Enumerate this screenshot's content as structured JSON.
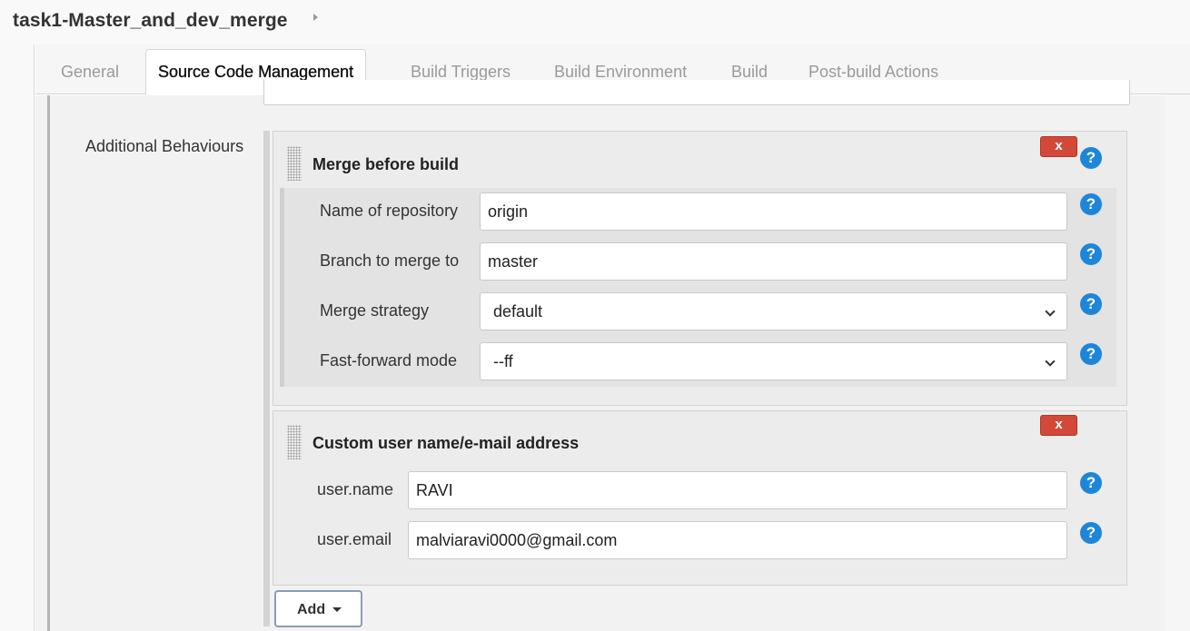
{
  "header": {
    "job_title": "task1-Master_and_dev_merge"
  },
  "tabs": [
    {
      "label": "General",
      "active": false
    },
    {
      "label": "Source Code Management",
      "active": true
    },
    {
      "label": "Build Triggers",
      "active": false
    },
    {
      "label": "Build Environment",
      "active": false
    },
    {
      "label": "Build",
      "active": false
    },
    {
      "label": "Post-build Actions",
      "active": false
    }
  ],
  "scm": {
    "additional_behaviours_label": "Additional Behaviours",
    "merge_before_build": {
      "title": "Merge before build",
      "delete_label": "x",
      "fields": {
        "repo_name": {
          "label": "Name of repository",
          "value": "origin"
        },
        "branch": {
          "label": "Branch to merge to",
          "value": "master"
        },
        "strategy": {
          "label": "Merge strategy",
          "value": "default"
        },
        "ff_mode": {
          "label": "Fast-forward mode",
          "value": "--ff"
        }
      }
    },
    "custom_user": {
      "title": "Custom user name/e-mail address",
      "delete_label": "x",
      "fields": {
        "user_name": {
          "label": "user.name",
          "value": "RAVI"
        },
        "user_email": {
          "label": "user.email",
          "value": "malviaravi0000@gmail.com"
        }
      }
    },
    "add_button_label": "Add"
  },
  "icons": {
    "help": "?"
  },
  "colors": {
    "delete_button": "#d24939",
    "help_icon": "#1e86d9",
    "add_button_border": "#8b9cb5"
  }
}
